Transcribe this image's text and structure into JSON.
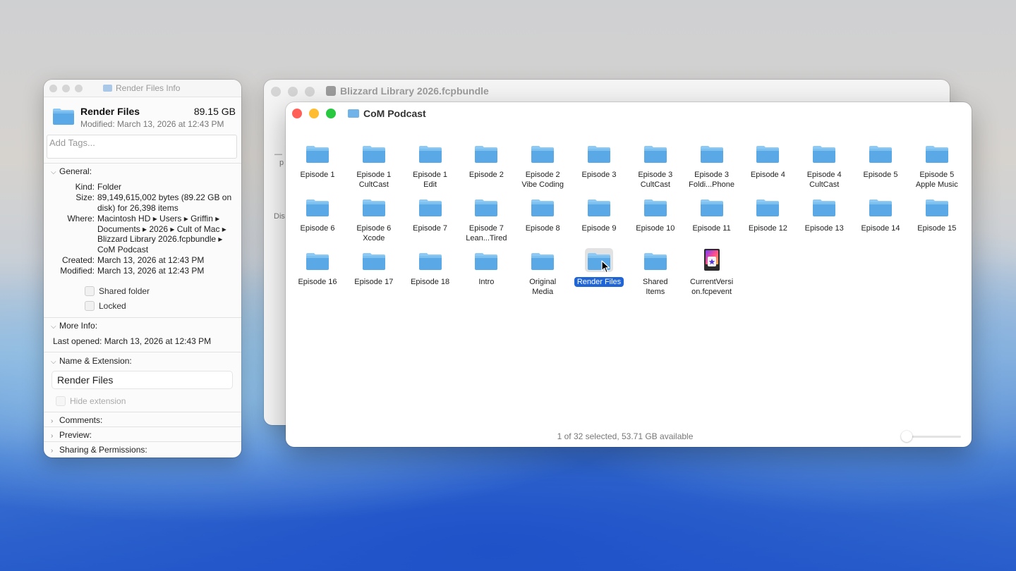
{
  "info_window": {
    "title": "Render Files Info",
    "name": "Render Files",
    "size": "89.15 GB",
    "modified_line": "Modified: March 13, 2026 at 12:43 PM",
    "tags_placeholder": "Add Tags...",
    "general": {
      "header": "General:",
      "kind_label": "Kind:",
      "kind": "Folder",
      "size_label": "Size:",
      "size": "89,149,615,002 bytes (89.22 GB on disk) for 26,398 items",
      "where_label": "Where:",
      "where": "Macintosh HD ▸ Users ▸ Griffin ▸ Documents ▸ 2026 ▸ Cult of Mac ▸ Blizzard Library 2026.fcpbundle ▸ CoM Podcast",
      "created_label": "Created:",
      "created": "March 13, 2026 at 12:43 PM",
      "modified_label": "Modified:",
      "modified": "March 13, 2026 at 12:43 PM",
      "shared_folder": "Shared folder",
      "locked": "Locked"
    },
    "more_info": {
      "header": "More Info:",
      "last_opened": "Last opened: March 13, 2026 at 12:43 PM"
    },
    "name_ext": {
      "header": "Name & Extension:",
      "value": "Render Files",
      "hide_extension": "Hide extension"
    },
    "comments_header": "Comments:",
    "preview_header": "Preview:",
    "sharing_header": "Sharing & Permissions:"
  },
  "back_window": {
    "title": "Blizzard Library 2026.fcpbundle",
    "frag1": "—",
    "frag2": "p",
    "frag3": "Dis"
  },
  "finder": {
    "title": "CoM Podcast",
    "status": "1 of 32 selected, 53.71 GB available",
    "zoom_level": 0.05,
    "items": [
      {
        "l1": "Episode 1",
        "l2": ""
      },
      {
        "l1": "Episode 1",
        "l2": "CultCast"
      },
      {
        "l1": "Episode 1",
        "l2": "Edit"
      },
      {
        "l1": "Episode 2",
        "l2": ""
      },
      {
        "l1": "Episode 2",
        "l2": "Vibe Coding"
      },
      {
        "l1": "Episode 3",
        "l2": ""
      },
      {
        "l1": "Episode 3",
        "l2": "CultCast"
      },
      {
        "l1": "Episode 3",
        "l2": "Foldi...Phone"
      },
      {
        "l1": "Episode 4",
        "l2": ""
      },
      {
        "l1": "Episode 4",
        "l2": "CultCast"
      },
      {
        "l1": "Episode 5",
        "l2": ""
      },
      {
        "l1": "Episode 5",
        "l2": "Apple Music"
      },
      {
        "l1": "Episode 6",
        "l2": ""
      },
      {
        "l1": "Episode 6",
        "l2": "Xcode"
      },
      {
        "l1": "Episode 7",
        "l2": ""
      },
      {
        "l1": "Episode 7",
        "l2": "Lean...Tired"
      },
      {
        "l1": "Episode 8",
        "l2": ""
      },
      {
        "l1": "Episode 9",
        "l2": ""
      },
      {
        "l1": "Episode 10",
        "l2": ""
      },
      {
        "l1": "Episode 11",
        "l2": ""
      },
      {
        "l1": "Episode 12",
        "l2": ""
      },
      {
        "l1": "Episode 13",
        "l2": ""
      },
      {
        "l1": "Episode 14",
        "l2": ""
      },
      {
        "l1": "Episode 15",
        "l2": ""
      },
      {
        "l1": "Episode 16",
        "l2": ""
      },
      {
        "l1": "Episode 17",
        "l2": ""
      },
      {
        "l1": "Episode 18",
        "l2": ""
      },
      {
        "l1": "Intro",
        "l2": ""
      },
      {
        "l1": "Original",
        "l2": "Media"
      },
      {
        "l1": "Render Files",
        "l2": "",
        "selected": true
      },
      {
        "l1": "Shared",
        "l2": "Items"
      },
      {
        "l1": "CurrentVersi",
        "l2": "on.fcpevent",
        "icon": "fcpevent-file-icon"
      }
    ]
  },
  "colors": {
    "folder_top": "#8cc9f5",
    "folder_body": "#5aa9e6",
    "selection": "#1f65d6",
    "close": "#ff5f57",
    "minimize": "#febc2e",
    "zoom": "#28c840"
  }
}
